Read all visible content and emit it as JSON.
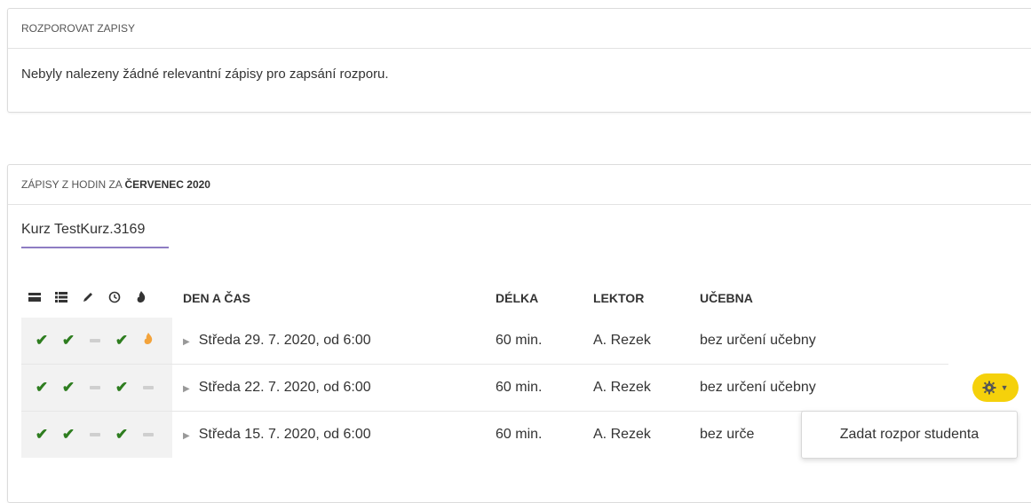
{
  "contest_panel": {
    "title": "ROZPOROVAT ZAPISY",
    "message": "Nebyly nalezeny žádné relevantní zápisy pro zapsání rozporu."
  },
  "lessons_panel": {
    "title_prefix": "ZÁPISY Z HODIN ZA",
    "title_month": "ČERVENEC 2020",
    "tab_label": "Kurz TestKurz.3169",
    "columns": {
      "icon_1": "card-icon",
      "icon_2": "list-icon",
      "icon_3": "pencil-icon",
      "icon_4": "clock-icon",
      "icon_5": "flame-icon",
      "den": "DEN A ČAS",
      "delka": "DÉLKA",
      "lektor": "LEKTOR",
      "ucebna": "UČEBNA"
    },
    "rows": [
      {
        "day": "Středa 29. 7. 2020, od 6:00",
        "length": "60 min.",
        "lector": "A. Rezek",
        "room": "bez určení učebny"
      },
      {
        "day": "Středa 22. 7. 2020, od 6:00",
        "length": "60 min.",
        "lector": "A. Rezek",
        "room": "bez určení učebny"
      },
      {
        "day": "Středa 15. 7. 2020, od 6:00",
        "length": "60 min.",
        "lector": "A. Rezek",
        "room": "bez urče"
      }
    ],
    "actions_menu": {
      "icon": "gear-icon",
      "item": "Zadat rozpor studenta"
    }
  },
  "colors": {
    "check": "#2e7d1f",
    "flame": "#f3a33b",
    "gear_button": "#f5d10b",
    "tab_underline": "#8e7cc3"
  }
}
